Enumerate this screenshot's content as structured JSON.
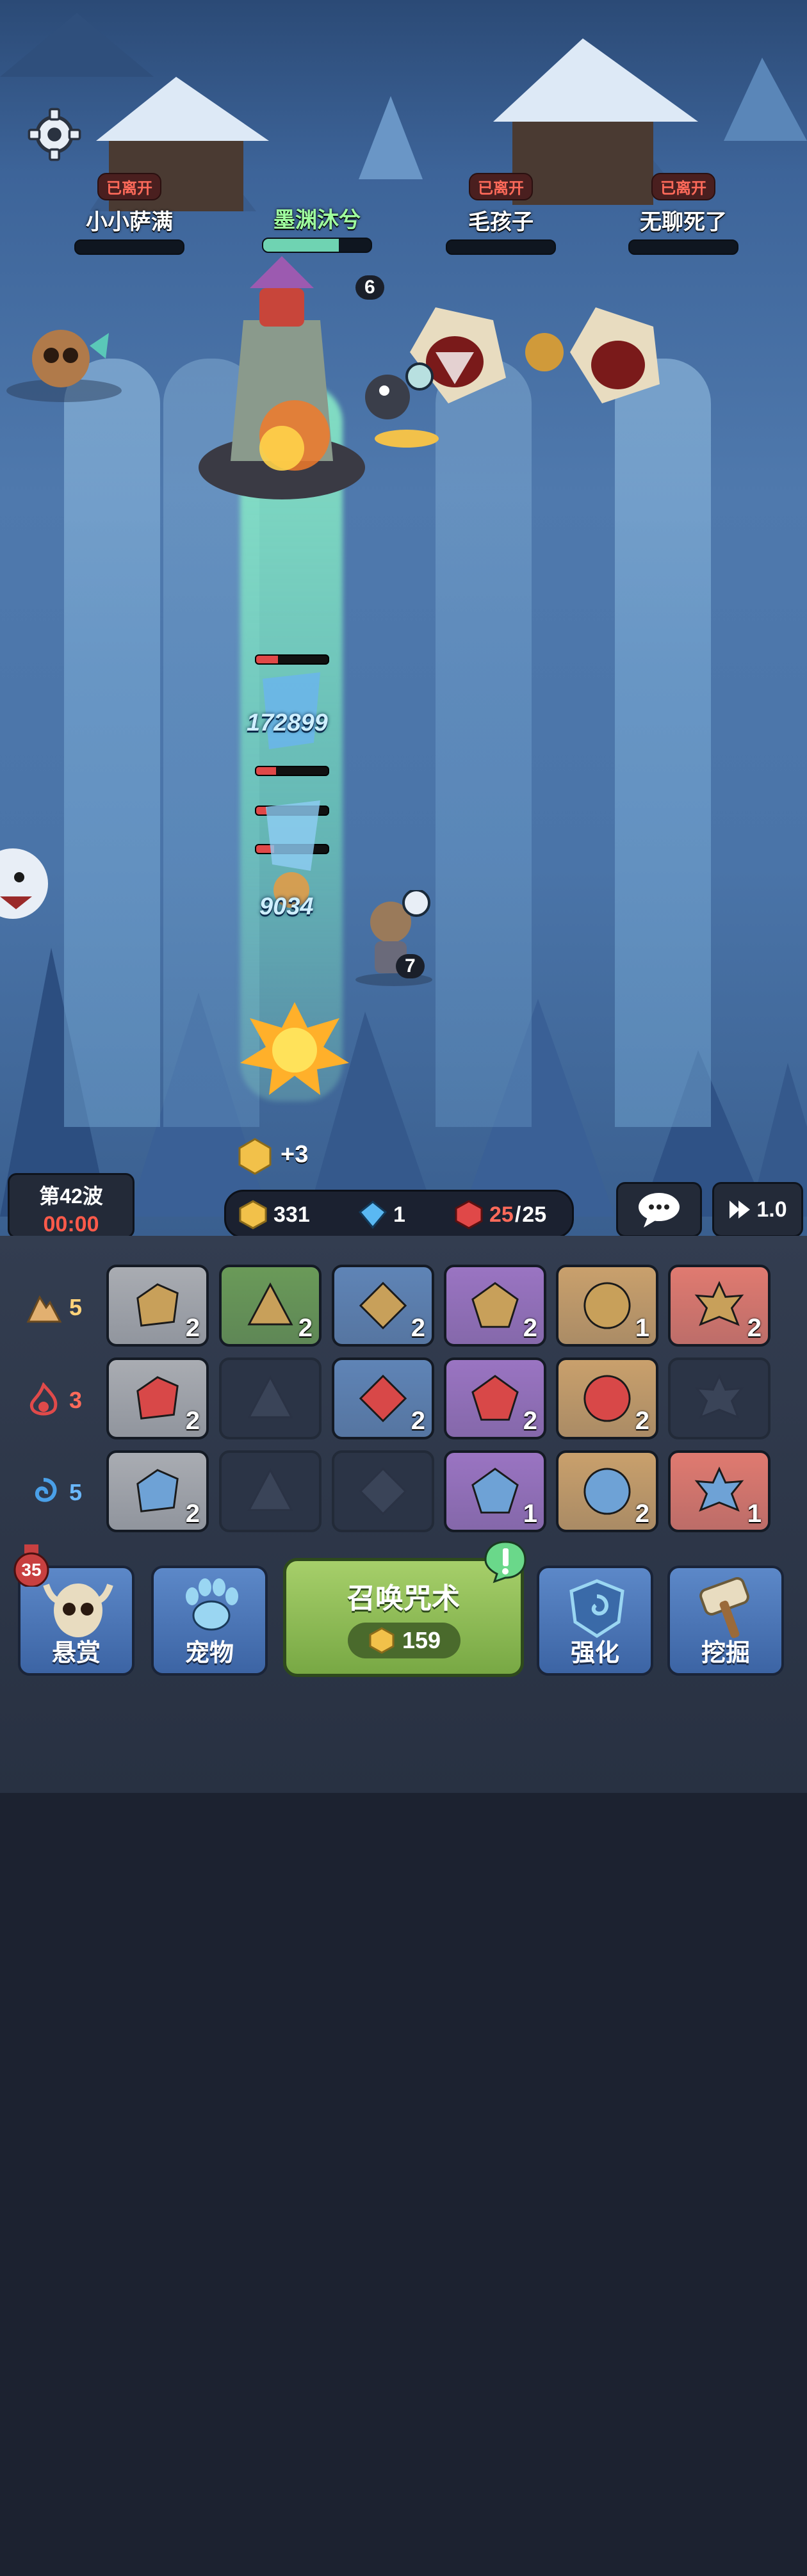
{
  "players": [
    {
      "status": "已离开",
      "name": "小小萨满",
      "hp": 0
    },
    {
      "status": "",
      "name": "墨渊沐兮",
      "hp": 0.7
    },
    {
      "status": "已离开",
      "name": "毛孩子",
      "hp": 0
    },
    {
      "status": "已离开",
      "name": "无聊死了",
      "hp": 0
    }
  ],
  "battle": {
    "boss_level": "6",
    "hero_level": "7",
    "damage_1": "172899",
    "damage_2": "9034",
    "coin_popup": "+3"
  },
  "hud": {
    "wave_label": "第42波",
    "timer": "00:00",
    "gold": "331",
    "gems": "1",
    "units_current": "25",
    "units_sep": "/",
    "units_max": "25",
    "speed": "1.0"
  },
  "elements": [
    {
      "icon": "earth-icon",
      "count": "5",
      "color": "#e2b070"
    },
    {
      "icon": "fire-icon",
      "count": "3",
      "color": "#e04a4a"
    },
    {
      "icon": "water-icon",
      "count": "5",
      "color": "#4aa0e8"
    }
  ],
  "cards": [
    [
      {
        "count": "2",
        "bg": "#a9acb2",
        "emb": "#c8a05a"
      },
      {
        "count": "2",
        "bg": "#6a9a58",
        "emb": "#c8a05a"
      },
      {
        "count": "2",
        "bg": "#5f84b6",
        "emb": "#c8a05a"
      },
      {
        "count": "2",
        "bg": "#9a74c2",
        "emb": "#c8a05a"
      },
      {
        "count": "1",
        "bg": "#c9a06c",
        "emb": "#c8a05a"
      },
      {
        "count": "2",
        "bg": "#e07a70",
        "emb": "#c8a05a"
      }
    ],
    [
      {
        "count": "2",
        "bg": "#a9acb2",
        "emb": "#d84848"
      },
      {
        "count": "",
        "bg": "",
        "emb": ""
      },
      {
        "count": "2",
        "bg": "#5f84b6",
        "emb": "#d84848"
      },
      {
        "count": "2",
        "bg": "#9a74c2",
        "emb": "#d84848"
      },
      {
        "count": "2",
        "bg": "#c9a06c",
        "emb": "#d84848"
      },
      {
        "count": "",
        "bg": "",
        "emb": ""
      }
    ],
    [
      {
        "count": "2",
        "bg": "#a9acb2",
        "emb": "#6ea2d6"
      },
      {
        "count": "",
        "bg": "",
        "emb": ""
      },
      {
        "count": "",
        "bg": "",
        "emb": ""
      },
      {
        "count": "1",
        "bg": "#9a74c2",
        "emb": "#6ea2d6"
      },
      {
        "count": "2",
        "bg": "#c9a06c",
        "emb": "#6ea2d6"
      },
      {
        "count": "1",
        "bg": "#e07a70",
        "emb": "#6ea2d6"
      }
    ]
  ],
  "buttons": {
    "bounty_badge": "35",
    "bounty": "悬赏",
    "pets": "宠物",
    "summon": "召唤咒术",
    "summon_cost": "159",
    "upgrade": "强化",
    "dig": "挖掘"
  },
  "colors": {
    "accent_green": "#9fff9f",
    "panel": "#333d50",
    "gold": "#f2c14a"
  }
}
